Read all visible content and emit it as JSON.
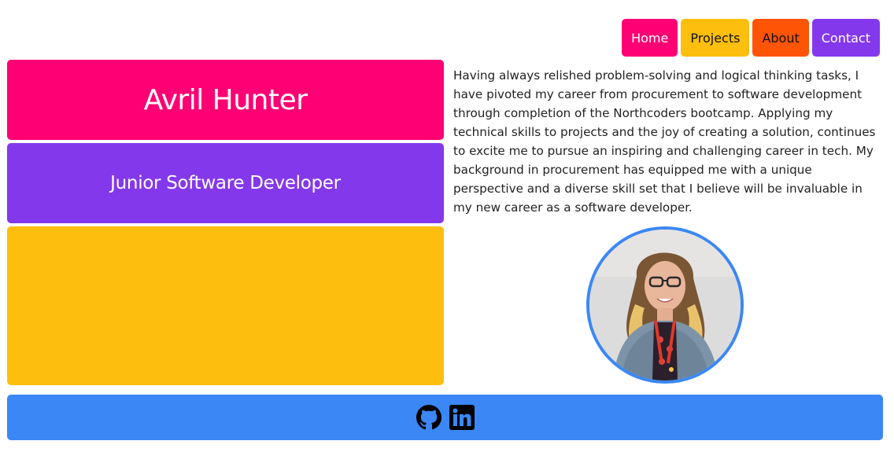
{
  "nav": {
    "items": [
      {
        "label": "Home",
        "bg": "#ff0074",
        "fg": "#ffffff"
      },
      {
        "label": "Projects",
        "bg": "#fdbe0d",
        "fg": "#111111"
      },
      {
        "label": "About",
        "bg": "#fd5406",
        "fg": "#111111"
      },
      {
        "label": "Contact",
        "bg": "#8438eb",
        "fg": "#ffffff"
      }
    ]
  },
  "hero": {
    "name": "Avril Hunter",
    "role": "Junior Software Developer"
  },
  "bio": "Having always relished problem-solving and logical thinking tasks, I have pivoted my career from procurement to software development through completion of the Northcoders bootcamp. Applying my technical skills to projects and the joy of creating a solution, continues to excite me to pursue an inspiring and challenging career in tech. My background in procurement has equipped me with a unique perspective and a diverse skill set that I believe will be invaluable in my new career as a software developer.",
  "colors": {
    "pink": "#ff0074",
    "purple": "#8438eb",
    "yellow": "#fdbe0d",
    "orange": "#fd5406",
    "blue": "#3b87f5"
  },
  "footer": {
    "icons": [
      "github-icon",
      "linkedin-icon"
    ]
  }
}
